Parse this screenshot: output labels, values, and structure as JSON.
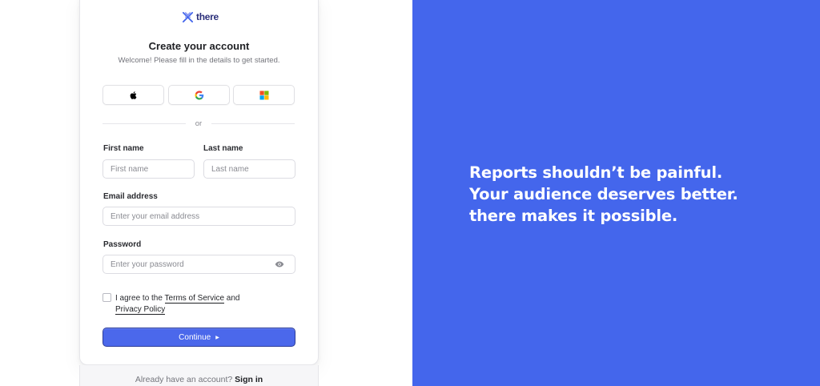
{
  "brand": {
    "name": "there",
    "color": "#2b2f7a"
  },
  "form": {
    "title": "Create your account",
    "subtitle": "Welcome! Please fill in the details to get started.",
    "social": [
      {
        "provider": "apple",
        "icon": "apple-icon"
      },
      {
        "provider": "google",
        "icon": "google-icon"
      },
      {
        "provider": "microsoft",
        "icon": "microsoft-icon"
      }
    ],
    "divider_text": "or",
    "first_name": {
      "label": "First name",
      "placeholder": "First name",
      "value": ""
    },
    "last_name": {
      "label": "Last name",
      "placeholder": "Last name",
      "value": ""
    },
    "email": {
      "label": "Email address",
      "placeholder": "Enter your email address",
      "value": ""
    },
    "password": {
      "label": "Password",
      "placeholder": "Enter your password",
      "value": "",
      "icon": "eye-icon"
    },
    "terms": {
      "prefix": "I agree to the",
      "terms_link": "Terms of Service",
      "middle": "and",
      "privacy_link": "Privacy Policy",
      "checked": false
    },
    "continue_label": "Continue",
    "continue_icon": "triangle-right-icon"
  },
  "footer": {
    "text": "Already have an account?",
    "sign_in": "Sign in"
  },
  "hero": {
    "lines": [
      "Reports shouldn’t be painful.",
      "Your audience deserves better.",
      "there makes it possible."
    ],
    "background": "#4466ec"
  },
  "colors": {
    "primary": "#4b68eb",
    "hero_bg": "#4466ec"
  }
}
